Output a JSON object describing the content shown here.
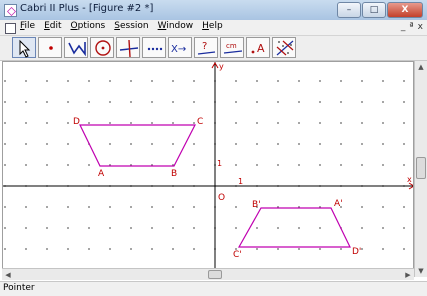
{
  "window": {
    "title": "Cabri II Plus - [Figure #2 *]",
    "buttons": [
      "–",
      "□",
      "X"
    ]
  },
  "menubar": {
    "items": [
      "File",
      "Edit",
      "Options",
      "Session",
      "Window",
      "Help"
    ],
    "mdi_buttons": [
      "_",
      "ª",
      "x"
    ]
  },
  "toolbar": {
    "tools": [
      {
        "icon": "pointer-arrow-icon"
      },
      {
        "icon": "point-icon"
      },
      {
        "icon": "polygon-icon"
      },
      {
        "icon": "circle-icon"
      },
      {
        "icon": "perpendicular-line-icon"
      },
      {
        "icon": "dotted-line-icon"
      },
      {
        "icon": "transform-arrow-icon",
        "label": "X→"
      },
      {
        "icon": "question-measure-icon",
        "label": "?"
      },
      {
        "icon": "distance-cm-icon",
        "label": "cm"
      },
      {
        "icon": "text-label-icon",
        "label": "A"
      },
      {
        "icon": "grid-attributes-icon"
      }
    ]
  },
  "figure": {
    "axis": {
      "x_label": "x",
      "y_label": "y",
      "origin_label": "O",
      "x_unit_label": "1",
      "y_unit_label": "1"
    },
    "quad1": {
      "A": "A",
      "B": "B",
      "C": "C",
      "D": "D"
    },
    "quad2": {
      "A": "A'",
      "B": "B'",
      "C": "C'",
      "D": "D'"
    },
    "color": "#c000b0"
  },
  "status": {
    "text": "Pointer"
  }
}
